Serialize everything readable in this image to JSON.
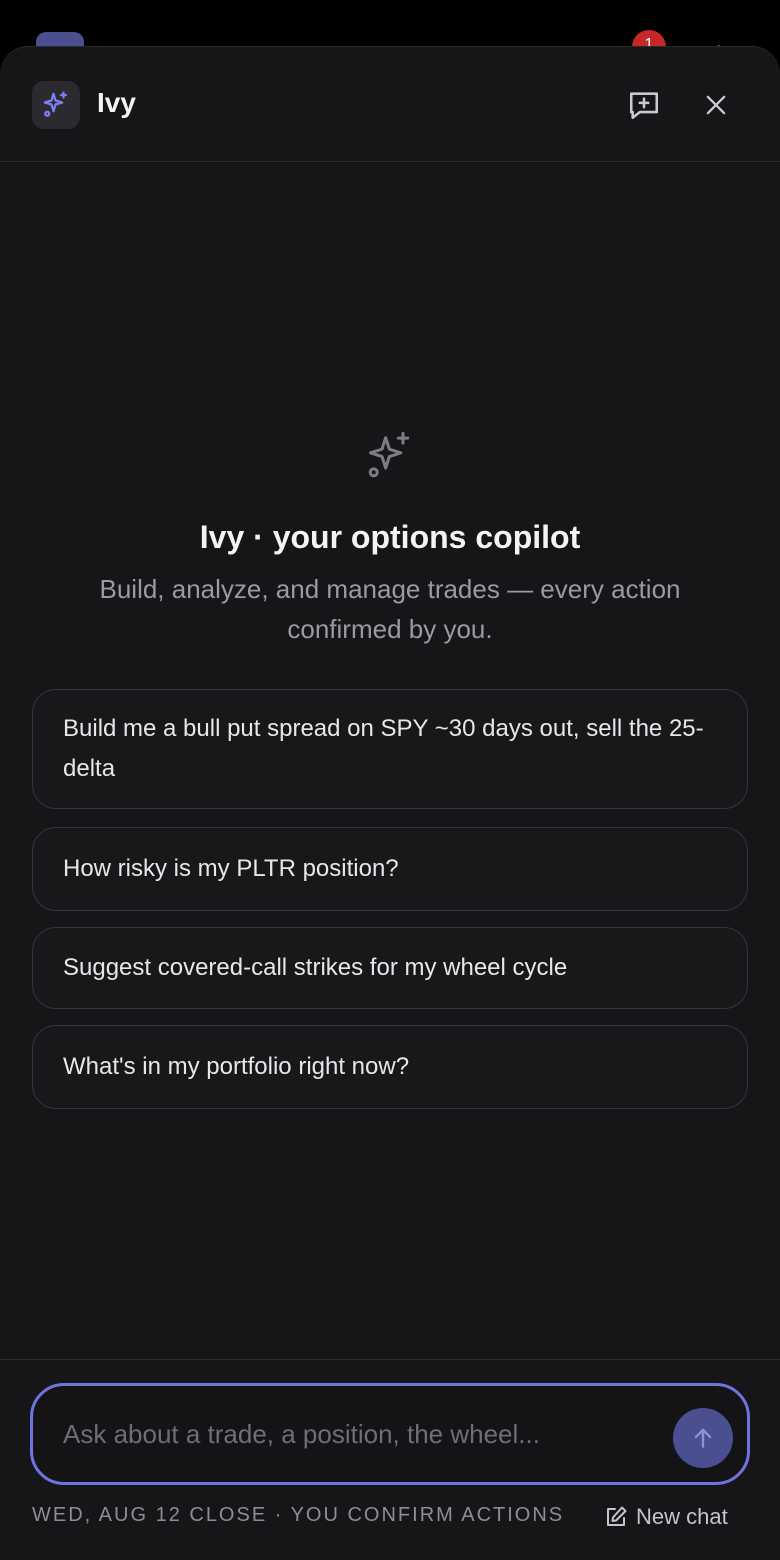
{
  "background": {
    "notification_badge": "1"
  },
  "header": {
    "app_name": "Ivy",
    "logo_icon": "sparkles-icon",
    "new_chat_icon": "message-plus-icon",
    "close_icon": "close-icon"
  },
  "hero": {
    "icon": "sparkles-icon",
    "title": "Ivy · your options copilot",
    "subtitle": "Build, analyze, and manage trades — every action confirmed by you."
  },
  "suggestions": [
    {
      "label": "Build me a bull put spread on SPY ~30 days out, sell the 25-delta"
    },
    {
      "label": "How risky is my PLTR position?"
    },
    {
      "label": "Suggest covered-call strikes for my wheel cycle"
    },
    {
      "label": "What's in my portfolio right now?"
    }
  ],
  "composer": {
    "placeholder": "Ask about a trade, a position, the wheel...",
    "value": "",
    "send_icon": "arrow-up-icon"
  },
  "footer": {
    "note": "WED, AUG 12 CLOSE · YOU CONFIRM ACTIONS",
    "new_chat_label": "New chat",
    "new_chat_icon": "edit-icon"
  },
  "colors": {
    "accent": "#6f74e0",
    "panel": "#161618",
    "badge": "#c62828"
  }
}
